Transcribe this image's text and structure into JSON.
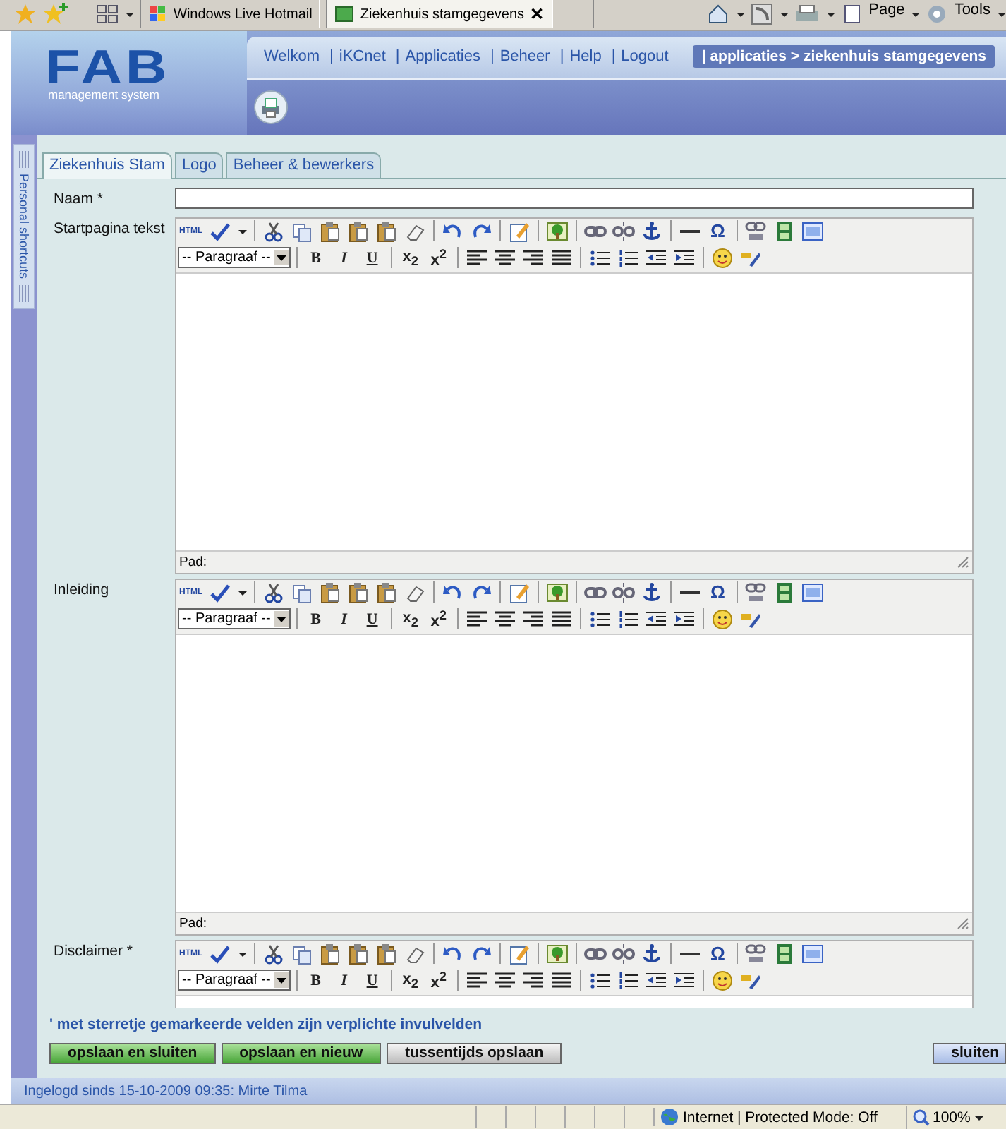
{
  "browser": {
    "tabs": [
      {
        "title": "Windows Live Hotmail",
        "selected": false
      },
      {
        "title": "Ziekenhuis stamgegevens",
        "selected": true,
        "close": "✕"
      }
    ],
    "commands": [
      {
        "label": "Page"
      },
      {
        "label": "Tools"
      }
    ]
  },
  "header": {
    "logo": "FAB",
    "tagline": "management system",
    "nav": [
      {
        "label": "Welkom"
      },
      {
        "label": "iKCnet"
      },
      {
        "label": "Applicaties"
      },
      {
        "label": "Beheer"
      },
      {
        "label": "Help"
      },
      {
        "label": "Logout"
      }
    ],
    "nav_separator": "|",
    "breadcrumb": "| applicaties > ziekenhuis stamgegevens"
  },
  "sidebar": {
    "label": "Personal shortcuts"
  },
  "tabs": [
    {
      "label": "Ziekenhuis Stam",
      "selected": true
    },
    {
      "label": "Logo",
      "selected": false
    },
    {
      "label": "Beheer & bewerkers",
      "selected": false
    }
  ],
  "fields": [
    {
      "kind": "text",
      "label": "Naam *"
    },
    {
      "kind": "editor",
      "label": "Startpagina tekst",
      "format": "-- Paragraaf --",
      "glyphs": {
        "html": "HTML",
        "omega": "Ω",
        "bold": "B",
        "italic": "I",
        "underline": "U",
        "sub": "x$_{2}$",
        "sup": "x$^{2}$"
      },
      "path_label": "Pad:"
    },
    {
      "kind": "editor",
      "label": "Inleiding",
      "format": "-- Paragraaf --",
      "glyphs": {
        "html": "HTML",
        "omega": "Ω",
        "bold": "B",
        "italic": "I",
        "underline": "U",
        "sub": "x$_{2}$",
        "sup": "x$^{2}$"
      },
      "path_label": "Pad:"
    },
    {
      "kind": "editor",
      "label": "Disclaimer *",
      "format": "-- Paragraaf --",
      "glyphs": {
        "html": "HTML",
        "omega": "Ω",
        "bold": "B",
        "italic": "I",
        "underline": "U",
        "sub": "x$_{2}$",
        "sup": "x$^{2}$"
      }
    }
  ],
  "required_note": "' met sterretje gemarkeerde velden zijn verplichte invulvelden",
  "buttons": [
    {
      "label": "opslaan en sluiten",
      "kind": "primary"
    },
    {
      "label": "opslaan en nieuw",
      "kind": "primary"
    },
    {
      "label": "tussentijds opslaan",
      "kind": "secondary"
    },
    {
      "label": "sluiten",
      "kind": "close"
    }
  ],
  "login_status": "Ingelogd sinds 15-10-2009 09:35: Mirte Tilma",
  "status_bar": {
    "zone": "Internet | Protected Mode: Off",
    "zoom": "100%"
  }
}
